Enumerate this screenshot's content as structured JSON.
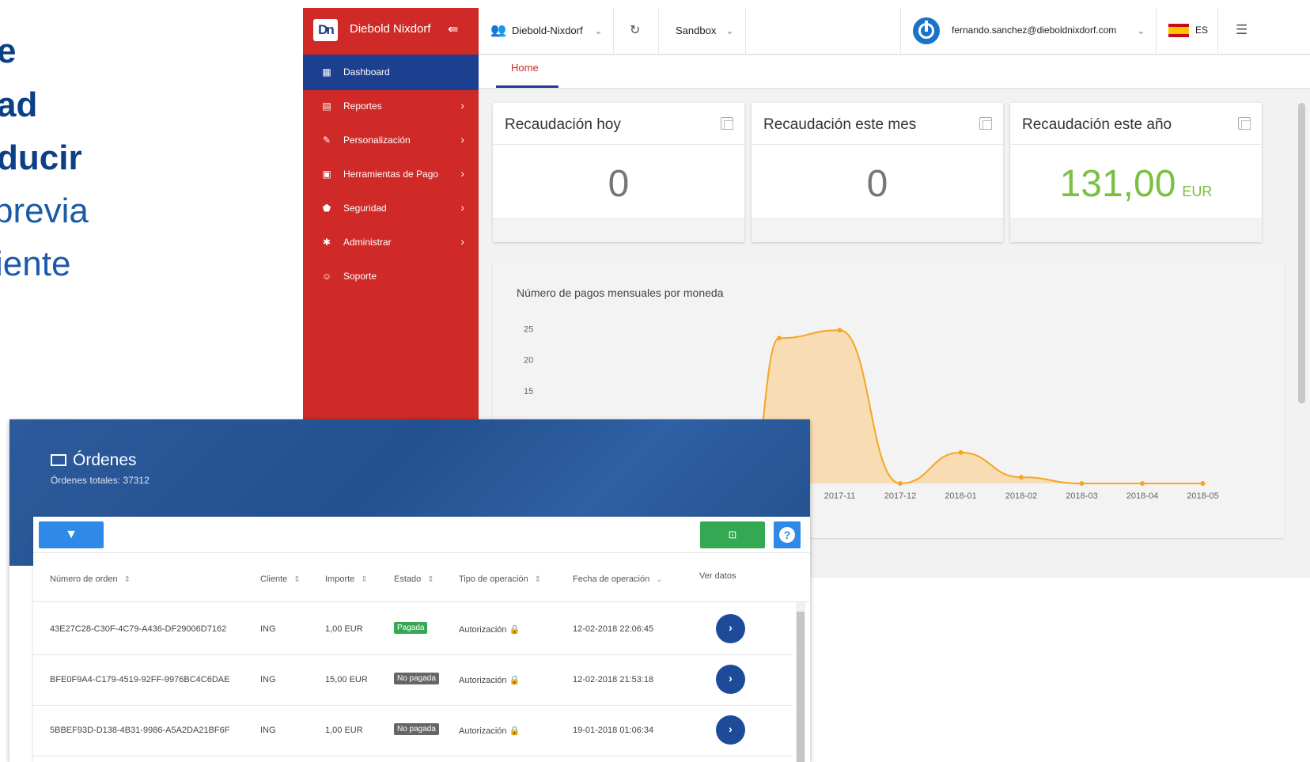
{
  "slide": {
    "lines": [
      "e",
      "ad",
      "ducir",
      "previa",
      "iente"
    ]
  },
  "dashboard": {
    "brand": "Diebold Nixdorf",
    "logo_text": "Dn",
    "sidebar": [
      {
        "label": "Dashboard",
        "icon": "dashboard-icon",
        "glyph": "▦",
        "active": true,
        "chevron": false
      },
      {
        "label": "Reportes",
        "icon": "clipboard-icon",
        "glyph": "▤",
        "active": false,
        "chevron": true
      },
      {
        "label": "Personalización",
        "icon": "brush-icon",
        "glyph": "✎",
        "active": false,
        "chevron": true
      },
      {
        "label": "Herramientas de Pago",
        "icon": "money-icon",
        "glyph": "▣",
        "active": false,
        "chevron": true
      },
      {
        "label": "Seguridad",
        "icon": "shield-icon",
        "glyph": "⬟",
        "active": false,
        "chevron": true
      },
      {
        "label": "Administrar",
        "icon": "gear-icon",
        "glyph": "✱",
        "active": false,
        "chevron": true
      },
      {
        "label": "Soporte",
        "icon": "support-icon",
        "glyph": "☺",
        "active": false,
        "chevron": false
      }
    ],
    "topbar": {
      "org": "Diebold-Nixdorf",
      "env": "Sandbox",
      "user": "fernando.sanchez@dieboldnixdorf.com",
      "lang": "ES"
    },
    "tab": "Home",
    "cards": [
      {
        "title": "Recaudación hoy",
        "value": "0",
        "unit": ""
      },
      {
        "title": "Recaudación este mes",
        "value": "0",
        "unit": ""
      },
      {
        "title": "Recaudación este año",
        "value": "131,00",
        "unit": "EUR"
      }
    ],
    "colors": {
      "red": "#cf2a27",
      "navy": "#1d3f8f",
      "green": "#7bc043",
      "orange": "#f5a623"
    }
  },
  "chart_data": {
    "type": "area",
    "title": "Número de pagos mensuales por moneda",
    "x": [
      "2017-11",
      "2017-12",
      "2018-01",
      "2018-02",
      "2018-03",
      "2018-04",
      "2018-05"
    ],
    "y_ticks": [
      15,
      20,
      25
    ],
    "visible_points": [
      {
        "x": "2017-10",
        "y": 23.5
      },
      {
        "x": "2017-11",
        "y": 24.8
      },
      {
        "x": "2017-12",
        "y": 0
      },
      {
        "x": "2018-01",
        "y": 5
      },
      {
        "x": "2018-02",
        "y": 1
      },
      {
        "x": "2018-03",
        "y": 0
      },
      {
        "x": "2018-04",
        "y": 0
      },
      {
        "x": "2018-05",
        "y": 0
      }
    ],
    "ylim": [
      0,
      27
    ],
    "color": "#f5a623",
    "fill": "#f8dcb4"
  },
  "orders": {
    "title": "Órdenes",
    "subtitle": "Órdenes totales: 37312",
    "columns": [
      "Número de orden",
      "Cliente",
      "Importe",
      "Estado",
      "Tipo de operación",
      "Fecha de operación",
      "Ver datos"
    ],
    "rows": [
      {
        "id": "43E27C28-C30F-4C79-A436-DF29006D7162",
        "client": "ING",
        "amount": "1,00 EUR",
        "status": "Pagada",
        "paid": true,
        "type": "Autorización 🔒",
        "date": "12-02-2018 22:06:45"
      },
      {
        "id": "BFE0F9A4-C179-4519-92FF-9976BC4C6DAE",
        "client": "ING",
        "amount": "15,00 EUR",
        "status": "No pagada",
        "paid": false,
        "type": "Autorización 🔒",
        "date": "12-02-2018 21:53:18"
      },
      {
        "id": "5BBEF93D-D138-4B31-9986-A5A2DA21BF6F",
        "client": "ING",
        "amount": "1,00 EUR",
        "status": "No pagada",
        "paid": false,
        "type": "Autorización 🔒",
        "date": "19-01-2018 01:06:34"
      }
    ]
  }
}
